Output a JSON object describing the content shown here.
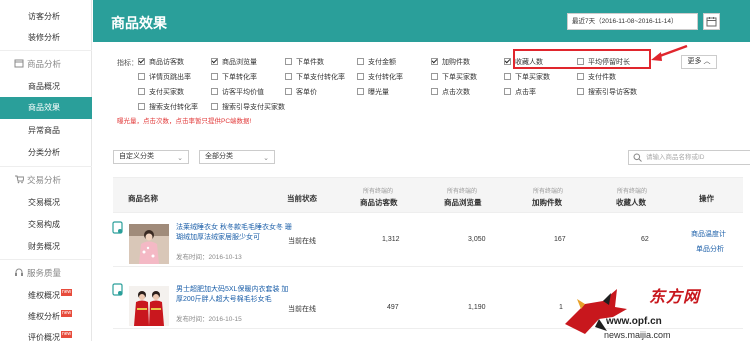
{
  "sidebar": {
    "items_top": [
      "访客分析",
      "装修分析"
    ],
    "groups": [
      {
        "label": "商品分析",
        "icon": "box-icon",
        "items": [
          "商品概况",
          "商品效果",
          "异常商品",
          "分类分析"
        ],
        "active": "商品效果"
      },
      {
        "label": "交易分析",
        "icon": "cart-icon",
        "items": [
          "交易概况",
          "交易构成",
          "财务概况"
        ]
      },
      {
        "label": "服务质量",
        "icon": "headset-icon",
        "items": [
          "维权概况",
          "维权分析",
          "评价概况"
        ],
        "new_badge": "new"
      }
    ]
  },
  "header": {
    "title": "商品效果",
    "date_range": "最近7天（2016-11-08~2016-11-14）"
  },
  "indicators": {
    "label": "指标：",
    "more": "更多",
    "options": [
      {
        "label": "商品访客数",
        "checked": true
      },
      {
        "label": "商品浏览量",
        "checked": true
      },
      {
        "label": "下单件数",
        "checked": false
      },
      {
        "label": "支付金额",
        "checked": false
      },
      {
        "label": "加购件数",
        "checked": true
      },
      {
        "label": "收藏人数",
        "checked": true
      },
      {
        "label": "平均停留时长",
        "checked": false
      },
      {
        "label": "详情页跳出率",
        "checked": false
      },
      {
        "label": "下单转化率",
        "checked": false
      },
      {
        "label": "下单支付转化率",
        "checked": false
      },
      {
        "label": "支付转化率",
        "checked": false
      },
      {
        "label": "下单买家数",
        "checked": false
      },
      {
        "label": "下单买家数",
        "checked": false
      },
      {
        "label": "支付件数",
        "checked": false
      },
      {
        "label": "支付买家数",
        "checked": false
      },
      {
        "label": "访客平均价值",
        "checked": false
      },
      {
        "label": "客单价",
        "checked": false
      },
      {
        "label": "曝光量",
        "checked": false
      },
      {
        "label": "点击次数",
        "checked": false
      },
      {
        "label": "点击率",
        "checked": false
      },
      {
        "label": "搜索引导访客数",
        "checked": false
      },
      {
        "label": "搜索支付转化率",
        "checked": false
      },
      {
        "label": "搜索引导支付买家数",
        "checked": false
      }
    ],
    "note": "曝光量，点击次数，点击率暂只提供PC端数据!"
  },
  "filters": {
    "category": "自定义分类",
    "all_category": "全部分类",
    "search_placeholder": "请输入商品名称或ID"
  },
  "table": {
    "headers": {
      "name": "商品名称",
      "status": "当前状态",
      "visitors": "商品访客数",
      "views": "商品浏览量",
      "cart": "加购件数",
      "fav": "收藏人数",
      "ops": "操作",
      "sub": "所有终端的"
    },
    "rows": [
      {
        "title": "法莱绒睡衣女 秋冬款毛毛睡衣女冬 珊瑚绒加厚法绒家居服少女可",
        "date": "发布时间：2016-10-13",
        "status": "当前在线",
        "visitors": "1,312",
        "views": "3,050",
        "cart": "167",
        "fav": "62",
        "op1": "商品温度计",
        "op2": "单品分析"
      },
      {
        "title": "男士超肥加大码5XL保暖内衣套装 加厚200斤胖人超大号棉毛衫女毛",
        "date": "发布时间：2016-10-15",
        "status": "当前在线",
        "visitors": "497",
        "views": "1,190",
        "cart": "1",
        "fav": "",
        "op1": "",
        "op2": ""
      }
    ]
  },
  "watermark": {
    "brand": "东方网",
    "url": "www.opf.cn",
    "url2": "news.maijia.com"
  },
  "colors": {
    "accent": "#2a9f9a",
    "link": "#1a5ea8",
    "warning": "#e23b3b",
    "highlight_box": "#e0262d"
  }
}
